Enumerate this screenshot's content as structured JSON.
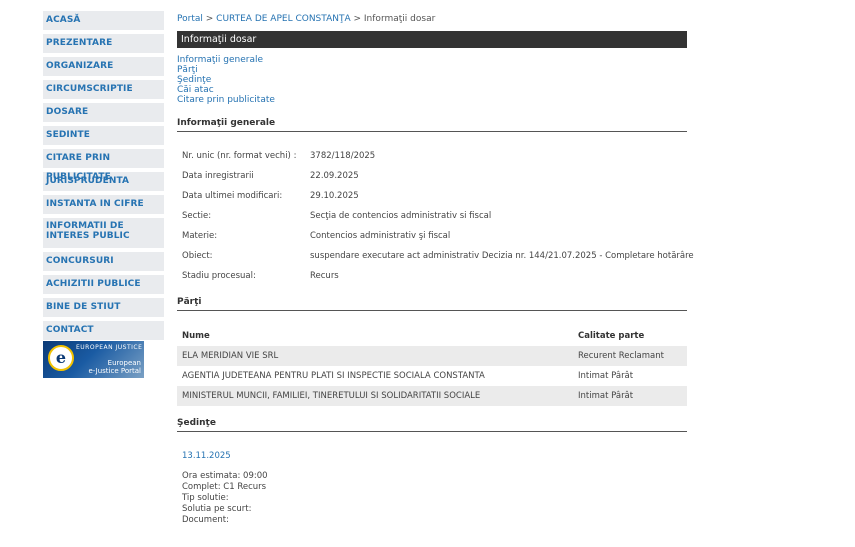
{
  "sidebar": {
    "items": [
      {
        "label": "ACASĂ"
      },
      {
        "label": "PREZENTARE"
      },
      {
        "label": "ORGANIZARE"
      },
      {
        "label": "CIRCUMSCRIPTIE"
      },
      {
        "label": "DOSARE"
      },
      {
        "label": "SEDINTE"
      },
      {
        "label": "CITARE PRIN PUBLICITATE"
      },
      {
        "label": "JURISPRUDENTA"
      },
      {
        "label": "INSTANTA IN CIFRE"
      },
      {
        "label": "INFORMATII DE INTERES PUBLIC"
      },
      {
        "label": "CONCURSURI"
      },
      {
        "label": "ACHIZITII PUBLICE"
      },
      {
        "label": "BINE DE STIUT"
      },
      {
        "label": "CONTACT"
      }
    ],
    "banner": {
      "top_text": "EUROPEAN JUSTICE",
      "brand_line1": "European",
      "brand_line2": "e-Justice Portal",
      "logo_letter": "e"
    }
  },
  "breadcrumb": {
    "portal": "Portal",
    "sep": ">",
    "court": "CURTEA DE APEL CONSTANŢA",
    "current": "Informaţii dosar"
  },
  "page_title": "Informaţii dosar",
  "quicklinks": [
    "Informaţii generale",
    "Părţi",
    "Şedinţe",
    "Căi atac",
    "Citare prin publicitate"
  ],
  "general": {
    "heading": "Informaţii generale",
    "rows": [
      {
        "label": "Nr. unic (nr. format vechi) :",
        "value": "3782/118/2025"
      },
      {
        "label": "Data inregistrarii",
        "value": "22.09.2025"
      },
      {
        "label": "Data ultimei modificari:",
        "value": "29.10.2025"
      },
      {
        "label": "Sectie:",
        "value": "Secţia de contencios administrativ si fiscal"
      },
      {
        "label": "Materie:",
        "value": "Contencios administrativ şi fiscal"
      },
      {
        "label": "Obiect:",
        "value": "suspendare executare act administrativ Decizia nr. 144/21.07.2025 - Completare hotărâre"
      },
      {
        "label": "Stadiu procesual:",
        "value": "Recurs"
      }
    ]
  },
  "parties": {
    "heading": "Părţi",
    "columns": [
      "Nume",
      "Calitate parte"
    ],
    "rows": [
      {
        "name": "ELA MERIDIAN VIE SRL",
        "role": "Recurent Reclamant"
      },
      {
        "name": "AGENTIA JUDETEANA PENTRU PLATI SI INSPECTIE SOCIALA CONSTANTA",
        "role": "Intimat Pârât"
      },
      {
        "name": "MINISTERUL MUNCII, FAMILIEI, TINERETULUI SI SOLIDARITATII SOCIALE",
        "role": "Intimat Pârât"
      }
    ]
  },
  "hearings": {
    "heading": "Şedinţe",
    "date": "13.11.2025",
    "fields": [
      "Ora estimata: 09:00",
      "Complet: C1 Recurs",
      "Tip solutie:",
      "Solutia pe scurt:",
      "Document:"
    ]
  },
  "colors": {
    "link": "#2673b2",
    "nav_bg": "#e9ebee",
    "title_bar": "#333333",
    "row_shade": "#ebebeb"
  }
}
